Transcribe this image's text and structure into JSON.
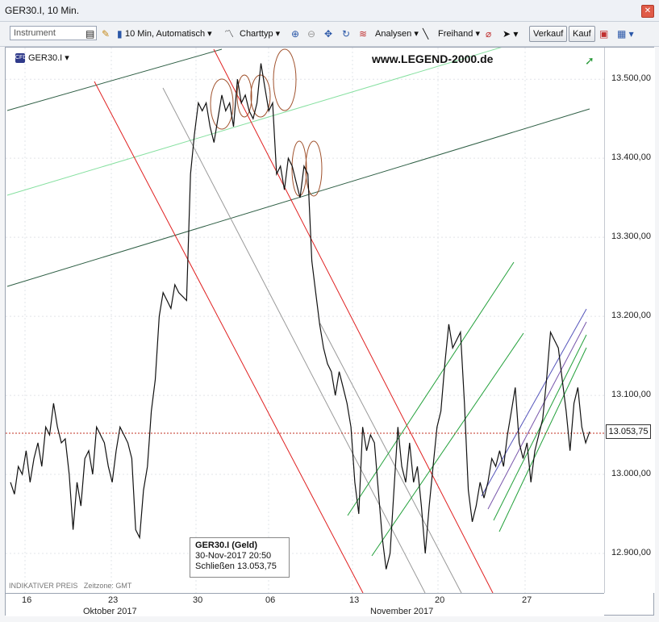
{
  "window": {
    "title": "GER30.I, 10 Min."
  },
  "toolbar": {
    "instrument_placeholder": "Instrument",
    "interval_label": "10 Min,",
    "mode_label": "Automatisch",
    "charttype_label": "Charttyp",
    "analysen_label": "Analysen",
    "freihand_label": "Freihand",
    "verkauf_label": "Verkauf",
    "kauf_label": "Kauf"
  },
  "chart": {
    "symbol": "GER30.I",
    "brand": "www.LEGEND-2000.de",
    "last_price": "13.053,75",
    "footer_left": "INDIKATIVER PREIS",
    "footer_tz": "Zeitzone: GMT",
    "tooltip": {
      "title": "GER30.I (Geld)",
      "date": "30-Nov-2017 20:50",
      "close_label": "Schließen",
      "close_value": "13.053,75"
    }
  },
  "chart_data": {
    "type": "line",
    "ylim": [
      12850,
      13540
    ],
    "y_ticks": [
      "13.500,00",
      "13.400,00",
      "13.300,00",
      "13.200,00",
      "13.100,00",
      "13.000,00",
      "12.900,00"
    ],
    "y_tick_values": [
      13500,
      13400,
      13300,
      13200,
      13100,
      13000,
      12900
    ],
    "x_ticks": [
      "16",
      "23",
      "30",
      "06",
      "13",
      "20",
      "27"
    ],
    "months": [
      "Oktober 2017",
      "November 2017"
    ],
    "last_value": 13053.75,
    "series": [
      {
        "values": [
          12990,
          12975,
          13010,
          13000,
          13030,
          12990,
          13020,
          13040,
          13010,
          13060,
          13050,
          13090,
          13060,
          13040,
          13045,
          13000,
          12930,
          12990,
          12960,
          13020,
          13030,
          13000,
          13060,
          13050,
          13040,
          13010,
          12990,
          13030,
          13060,
          13050,
          13040,
          13020,
          12930,
          12920,
          12980,
          13010,
          13080,
          13120,
          13200,
          13230,
          13220,
          13210,
          13240,
          13230,
          13225,
          13220,
          13380,
          13430,
          13470,
          13460,
          13470,
          13440,
          13420,
          13450,
          13480,
          13460,
          13470,
          13440,
          13500,
          13470,
          13480,
          13460,
          13450,
          13470,
          13520,
          13490,
          13460,
          13470,
          13380,
          13390,
          13360,
          13400,
          13390,
          13370,
          13350,
          13390,
          13380,
          13270,
          13230,
          13190,
          13160,
          13140,
          13130,
          13100,
          13130,
          13110,
          13090,
          13060,
          12990,
          12950,
          13060,
          13030,
          13050,
          13040,
          12980,
          12920,
          12880,
          12900,
          12980,
          13060,
          13010,
          12990,
          13040,
          12990,
          13010,
          12960,
          12900,
          12960,
          13010,
          13060,
          13080,
          13140,
          13190,
          13160,
          13170,
          13180,
          13090,
          12980,
          12940,
          12960,
          12990,
          12970,
          12990,
          13020,
          13010,
          13030,
          13010,
          13050,
          13080,
          13110,
          13040,
          13020,
          13040,
          12990,
          13030,
          13050,
          13070,
          13120,
          13180,
          13170,
          13160,
          13120,
          13080,
          13030,
          13090,
          13110,
          13060,
          13040,
          13054
        ]
      }
    ]
  }
}
